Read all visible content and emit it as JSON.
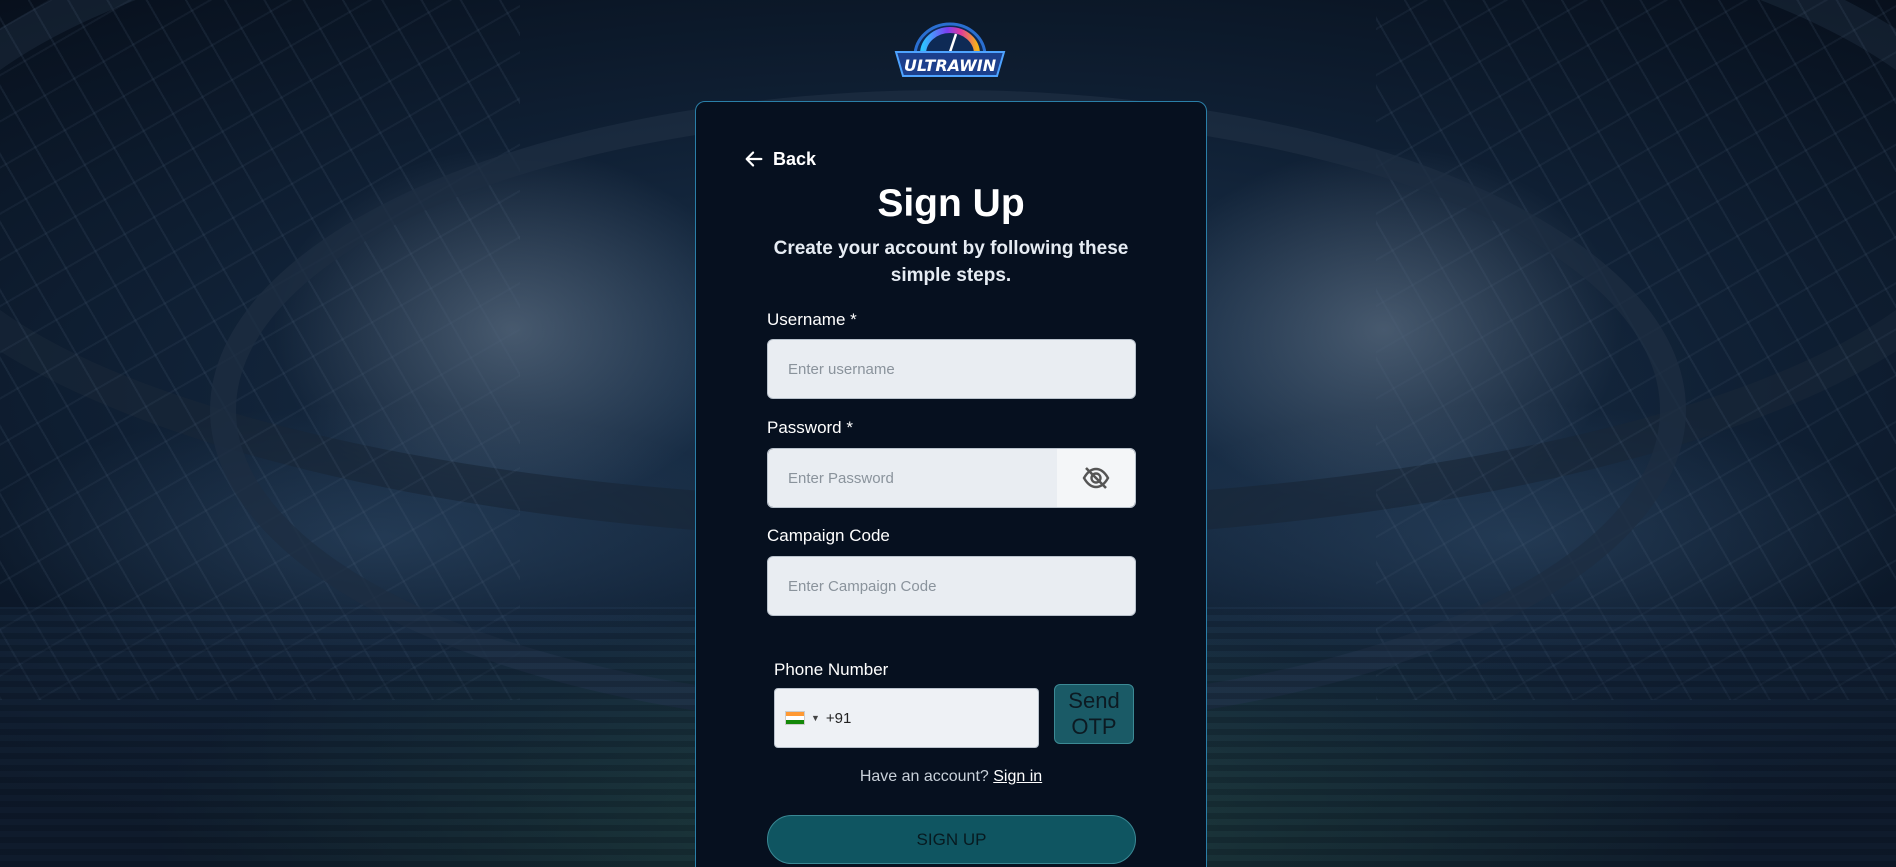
{
  "brand": {
    "logo_text": "ULTRAWIN"
  },
  "nav": {
    "back_label": "Back"
  },
  "header": {
    "title": "Sign Up",
    "subtitle": "Create your account by following these simple steps."
  },
  "form": {
    "username": {
      "label": "Username *",
      "placeholder": "Enter username",
      "value": ""
    },
    "password": {
      "label": "Password *",
      "placeholder": "Enter Password",
      "value": ""
    },
    "campaign": {
      "label": "Campaign Code",
      "placeholder": "Enter Campaign Code",
      "value": ""
    },
    "phone": {
      "label": "Phone Number",
      "value": "+91",
      "country": "India"
    },
    "otp_label": "Send OTP",
    "have_account": "Have an account?",
    "sign_in_label": "Sign in",
    "submit_label": "SIGN UP"
  },
  "icons": {
    "back": "arrow-left-icon",
    "password_toggle": "eye-off-icon",
    "flag": "india-flag-icon"
  },
  "colors": {
    "card_bg": "#06101f",
    "card_border": "#2a7fa8",
    "button_teal": "#0f5561",
    "input_bg": "#e9edf2"
  }
}
